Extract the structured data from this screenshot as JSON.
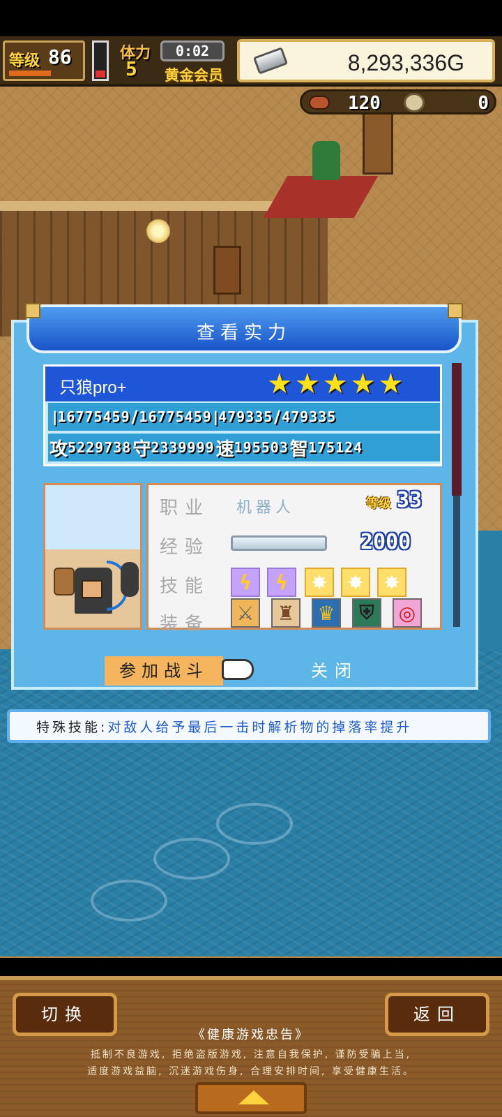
{
  "hud": {
    "level_label": "等级",
    "level": "86",
    "stamina_label": "体力",
    "stamina": "5",
    "timer": "0:02",
    "membership": "黄金会员",
    "gold": "8,293,336G",
    "meat": "120",
    "coins": "0"
  },
  "dialog": {
    "title": "查看实力",
    "character": {
      "name": "只狼pro+",
      "stars": 5,
      "hp": "16775459",
      "hp_max": "16775459",
      "mp": "479335",
      "mp_max": "479335",
      "atk_label": "攻",
      "atk": "5229738",
      "def_label": "守",
      "def": "2339999",
      "spd_label": "速",
      "spd": "195503",
      "int_label": "智",
      "int": "175124"
    },
    "info": {
      "job_label": "职业",
      "job": "机器人",
      "level_tag": "等级",
      "level": "33",
      "exp_label": "经验",
      "exp": "2000",
      "skill_label": "技能",
      "equip_label": "装备"
    },
    "skills": [
      "bolt-icon",
      "bolt-icon",
      "burst-icon",
      "burst-icon",
      "burst-icon"
    ],
    "equipment": [
      "sword-icon",
      "armor-icon",
      "helmet-icon",
      "shield-icon",
      "ring-icon"
    ],
    "fight_button": "参加战斗",
    "close_button": "关闭"
  },
  "special_skill": {
    "label": "特殊技能:",
    "text": "对敌人给予最后一击时解析物的掉落率提升"
  },
  "bottom": {
    "switch_button": "切换",
    "back_button": "返回",
    "advice_title": "《健康游戏忠告》",
    "advice_line1": "抵制不良游戏, 拒绝盗版游戏, 注意自我保护, 谨防受骗上当,",
    "advice_line2": "适度游戏益脑, 沉迷游戏伤身, 合理安排时间, 享受健康生活。"
  },
  "colors": {
    "dialog_bg": "#5eb6e8",
    "title_bar": "#1a54c8",
    "fight_button": "#f5b45e",
    "special_text": "#1e5ac8"
  }
}
